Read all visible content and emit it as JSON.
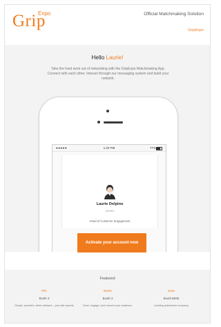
{
  "header": {
    "logo_text": "Grip",
    "logo_superscript": "Expo",
    "tagline": "Official Matchmaking Solution",
    "brand_link": "GripExpo"
  },
  "hero": {
    "greeting_prefix": "Hello ",
    "greeting_name": "Laurie!",
    "intro": "Take the hard work out of networking with the GripExpo Matchmaking App. Connect with each other. Interact through our messaging system and build your network."
  },
  "phone_screen": {
    "status_signal": "●●●●● ",
    "time": "1:20 PM",
    "battery": "77%",
    "profile_name": "Laurie Delpino",
    "profile_company": "Lumen",
    "profile_title": "Head of Customer Engagement"
  },
  "cta": {
    "label": "Activate your account now"
  },
  "footer": {
    "heading": "Featured",
    "items": [
      {
        "category": "Pitc",
        "booth": "Booth 3",
        "description": "Simple, powerful, sleek software – just visit experts"
      },
      {
        "category": "Beeln",
        "booth": "Booth 3",
        "description": "Grow, engage, and connect your audience."
      },
      {
        "category": "Soex",
        "booth": "Booth B005",
        "description": "Leading automotive company"
      }
    ]
  },
  "colors": {
    "accent": "#f07b1d",
    "background": "#f3f3f3"
  }
}
